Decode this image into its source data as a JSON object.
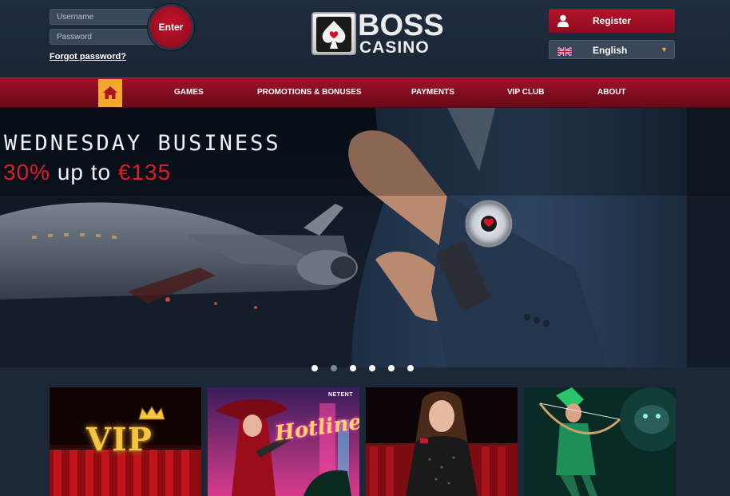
{
  "header": {
    "login": {
      "username_placeholder": "Username",
      "password_placeholder": "Password",
      "enter_label": "Enter",
      "forgot_label": "Forgot password?"
    },
    "logo": {
      "line1": "BOSS",
      "line2": "CASINO"
    },
    "register_label": "Register",
    "language": {
      "selected": "English",
      "flag": "uk-flag-icon"
    }
  },
  "nav": {
    "home_icon": "home-icon",
    "items": [
      "GAMES",
      "PROMOTIONS & BONUSES",
      "PAYMENTS",
      "VIP CLUB",
      "ABOUT"
    ]
  },
  "hero": {
    "title": "WEDNESDAY BUSINESS",
    "subtitle_highlight": "30%",
    "subtitle_rest": "up to",
    "subtitle_amount": "€135",
    "slide_count": 6,
    "active_slide": 2
  },
  "tiles": [
    {
      "name": "vip-tile",
      "text": "VIP"
    },
    {
      "name": "hotline-tile",
      "provider": "NETENT",
      "text": "Hotline"
    },
    {
      "name": "live-dealer-tile"
    },
    {
      "name": "archer-slot-tile"
    }
  ],
  "colors": {
    "accent_red": "#a01228",
    "home_yellow": "#f0a92d",
    "background": "#1c2838",
    "hero_red_text": "#e01b2a"
  }
}
